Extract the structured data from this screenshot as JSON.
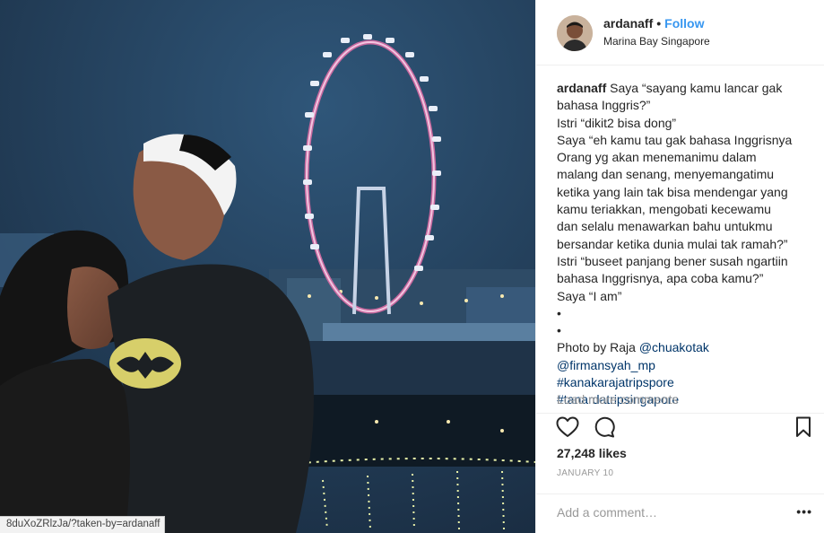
{
  "photo": {
    "alt": "Couple in front of Singapore Flyer",
    "status_url": "8duXoZRlzJa/?taken-by=ardanaff"
  },
  "post": {
    "username": "ardanaff",
    "dot": "•",
    "follow_label": "Follow",
    "location": "Marina Bay Singapore",
    "caption_user": "ardanaff",
    "caption_lines": [
      "Saya “sayang kamu lancar gak",
      "bahasa Inggris?”",
      "Istri “dikit2 bisa dong”",
      "Saya “eh kamu tau gak bahasa Inggrisnya",
      "Orang yg akan menemanimu dalam",
      "malang dan senang, menyemangatimu",
      "ketika yang lain tak bisa mendengar yang",
      "kamu teriakkan, mengobati kecewamu",
      "dan selalu menawarkan bahu untukmu",
      "bersandar ketika dunia mulai tak ramah?”",
      "Istri “buseet panjang bener susah ngartiin",
      "bahasa Inggrisnya, apa coba kamu?”",
      "Saya “I am”",
      "•",
      "•"
    ],
    "photo_by_prefix": "Photo by Raja ",
    "mention1": "@chuakotak",
    "mention2": "@firmansyah_mp",
    "hashtag1": "#kanakarajatripspore",
    "hashtag2": "#tanardatripsingapore",
    "load_more": "Load more comments",
    "likes": "27,248 likes",
    "date": "JANUARY 10",
    "comment_placeholder": "Add a comment…",
    "more_label": "•••"
  },
  "icons": [
    "heart-icon",
    "comment-icon",
    "bookmark-icon",
    "more-options-icon"
  ],
  "colors": {
    "link_blue": "#3897f0",
    "hashtag_navy": "#003569",
    "muted_grey": "#999999",
    "text": "#262626"
  }
}
